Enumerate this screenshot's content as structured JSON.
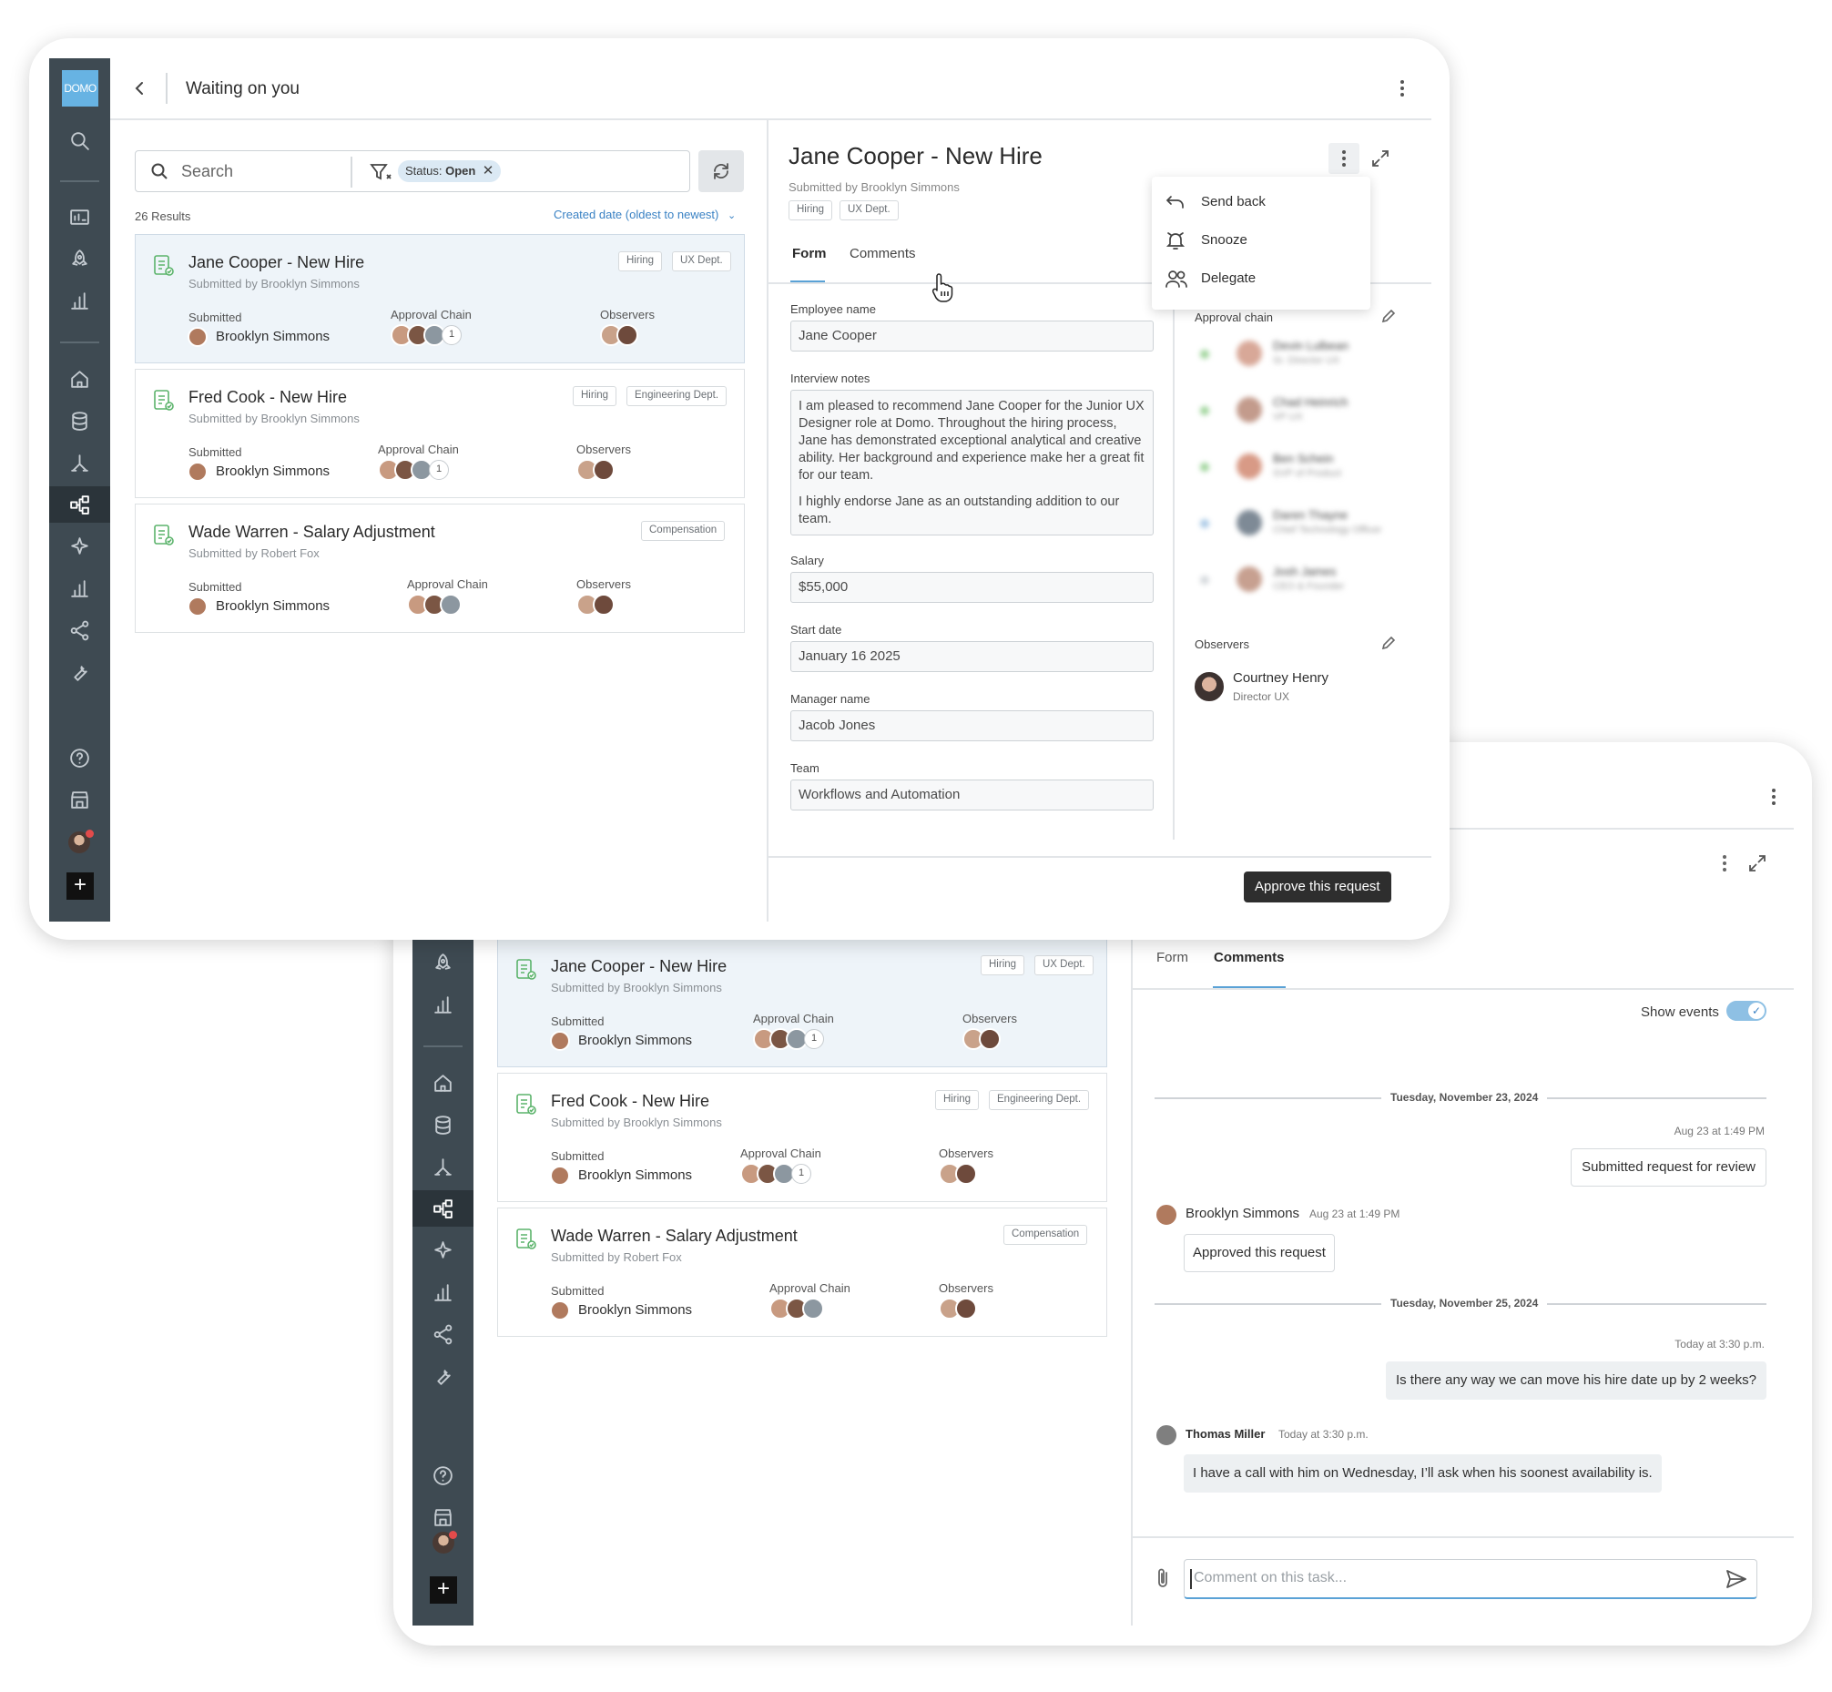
{
  "window_top": {
    "app_logo": "DOMO",
    "header_title": "Waiting on you",
    "search_placeholder": "Search",
    "filter_chip_prefix": "Status:",
    "filter_chip_value": "Open",
    "results_count": "26 Results",
    "sort_label": "Created date (oldest to newest)",
    "detail": {
      "title": "Jane Cooper - New Hire",
      "submitted_by": "Submitted by Brooklyn Simmons",
      "tags": [
        "Hiring",
        "UX Dept."
      ],
      "tabs": [
        "Form",
        "Comments"
      ],
      "active_tab": "Form",
      "menu_items": [
        "Send back",
        "Snooze",
        "Delegate"
      ],
      "form": {
        "employee_name_label": "Employee name",
        "employee_name_value": "Jane Cooper",
        "interview_notes_label": "Interview notes",
        "interview_notes_p1": "I am pleased to recommend Jane Cooper for the Junior UX Designer role at Domo. Throughout the hiring process, Jane has demonstrated exceptional analytical and creative ability. Her background and experience make her a great fit for our team.",
        "interview_notes_p2": "I highly endorse Jane as an outstanding addition to our team.",
        "salary_label": "Salary",
        "salary_value": "$55,000",
        "start_date_label": "Start date",
        "start_date_value": "January 16 2025",
        "manager_name_label": "Manager name",
        "manager_name_value": "Jacob Jones",
        "team_label": "Team",
        "team_value": "Workflows and Automation"
      },
      "approval_chain_label": "Approval chain",
      "approval_chain": [
        {
          "name": "Devin Lulbean",
          "role": "Sr. Director UX"
        },
        {
          "name": "Chad Heinrich",
          "role": "VP UX"
        },
        {
          "name": "Ben Schein",
          "role": "SVP of Product"
        },
        {
          "name": "Daren Thayne",
          "role": "Chief Technology Officer"
        },
        {
          "name": "Josh James",
          "role": "CEO & Founder"
        }
      ],
      "observers_label": "Observers",
      "observer_name": "Courtney Henry",
      "observer_role": "Director UX",
      "approve_button": "Approve this request"
    }
  },
  "cards": [
    {
      "title": "Jane Cooper - New Hire",
      "sub": "Submitted by Brooklyn Simmons",
      "tags": [
        "Hiring",
        "UX Dept."
      ],
      "submitted_label": "Submitted",
      "submitter": "Brooklyn Simmons",
      "chain_label": "Approval Chain",
      "chain_count": "1",
      "observers_label": "Observers"
    },
    {
      "title": "Fred Cook - New Hire",
      "sub": "Submitted by Brooklyn Simmons",
      "tags": [
        "Hiring",
        "Engineering Dept."
      ],
      "submitted_label": "Submitted",
      "submitter": "Brooklyn Simmons",
      "chain_label": "Approval Chain",
      "chain_count": "1",
      "observers_label": "Observers"
    },
    {
      "title": "Wade Warren - Salary Adjustment",
      "sub": "Submitted by Robert Fox",
      "tags": [
        "Compensation"
      ],
      "submitted_label": "Submitted",
      "submitter": "Brooklyn Simmons",
      "chain_label": "Approval Chain",
      "chain_count": "",
      "observers_label": "Observers"
    }
  ],
  "window_bottom": {
    "tabs": [
      "Form",
      "Comments"
    ],
    "active_tab": "Comments",
    "show_events_label": "Show events",
    "show_events_on": true,
    "date_sep_1": "Tuesday, November 23, 2024",
    "msg1_time": "Aug 23 at 1:49 PM",
    "msg1_text": "Submitted request for review",
    "msg2_author": "Brooklyn Simmons",
    "msg2_time": "Aug 23 at 1:49 PM",
    "msg2_text": "Approved this request",
    "date_sep_2": "Tuesday, November 25, 2024",
    "msg3_time": "Today at 3:30 p.m.",
    "msg3_text": "Is there any way we can move his hire date up by 2 weeks?",
    "msg4_author": "Thomas Miller",
    "msg4_time": "Today at 3:30 p.m.",
    "msg4_text": "I have a call with him on Wednesday, I’ll ask when his soonest availability is.",
    "comment_placeholder": "Comment on this task..."
  },
  "colors": {
    "rail": "#3e4a52",
    "accent": "#5aa2d6",
    "primary_button": "#2e2e2e",
    "card_selected": "#eef4f9",
    "tag_bg": "#dbe9f4"
  },
  "icons": [
    "search-icon",
    "dashboard-icon",
    "rocket-icon",
    "chart-icon",
    "home-icon",
    "database-icon",
    "dataflow-icon",
    "workflow-icon",
    "sparkle-icon",
    "bar-chart-icon",
    "share-icon",
    "wrench-icon",
    "help-icon",
    "store-icon",
    "add-icon"
  ]
}
